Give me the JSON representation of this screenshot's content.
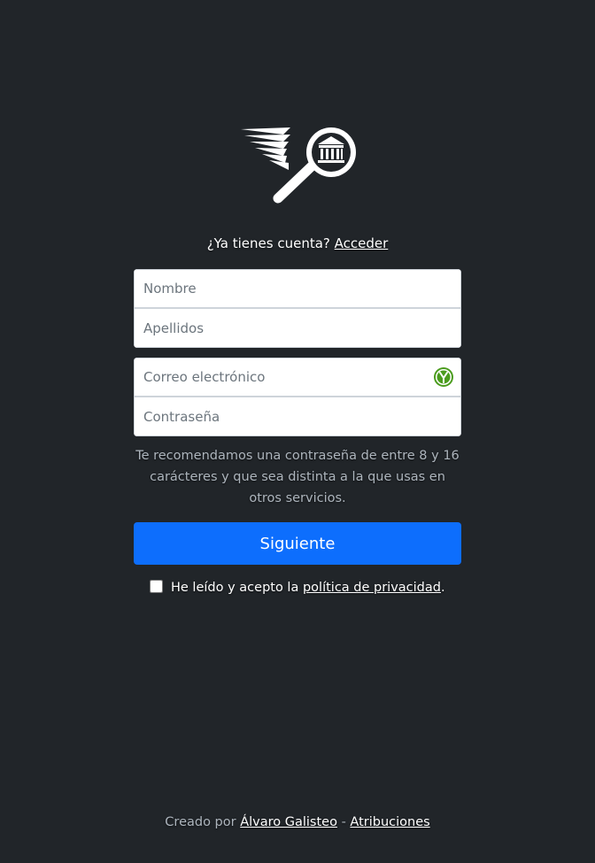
{
  "logo": {
    "icon": "winged-magnifier-museum-icon"
  },
  "login": {
    "prompt": "¿Ya tienes cuenta?",
    "link": "Acceder"
  },
  "form": {
    "nombre_placeholder": "Nombre",
    "apellidos_placeholder": "Apellidos",
    "email_placeholder": "Correo electrónico",
    "password_placeholder": "Contraseña",
    "password_hint": "Te recomendamos una contraseña de entre 8 y 16 carácteres y que sea distinta a la que usas en otros servicios.",
    "submit_label": "Siguiente",
    "privacy_prefix": "He leído y acepto la",
    "privacy_link": "política de privacidad",
    "privacy_suffix": "."
  },
  "footer": {
    "created_by": "Creado por",
    "author": "Álvaro Galisteo",
    "separator": "-",
    "attributions": "Atribuciones"
  },
  "colors": {
    "background": "#212529",
    "primary": "#0d6efd",
    "password_manager_icon": "#4b9c1e"
  }
}
